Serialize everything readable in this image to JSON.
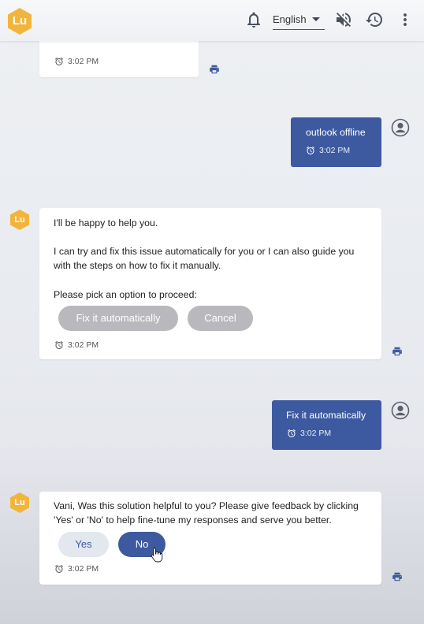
{
  "header": {
    "logo_text": "Lu",
    "language": "English"
  },
  "messages": {
    "top_partial": {
      "time": "3:02 PM"
    },
    "user1": {
      "text": "outlook offline",
      "time": "3:02 PM"
    },
    "bot1": {
      "line1": "I'll be happy to help you.",
      "line2": "I can try and fix this issue automatically for you or I can also guide you",
      "line3": "with the steps on how to fix it manually.",
      "line4": "Please pick an option to proceed:",
      "option_fix": "Fix it automatically",
      "option_cancel": "Cancel",
      "time": "3:02 PM"
    },
    "user2": {
      "text": "Fix it automatically",
      "time": "3:02 PM"
    },
    "bot2": {
      "line1": "Vani, Was this solution helpful to you? Please give feedback by clicking",
      "line2": "'Yes' or 'No' to help fine-tune my responses and serve you better.",
      "option_yes": "Yes",
      "option_no": "No",
      "time": "3:02 PM"
    }
  },
  "colors": {
    "accent": "#3d5aa0",
    "logo": "#f1b53c",
    "disabled_button": "#b9b9bd"
  },
  "icons": [
    "bell-icon",
    "chevron-down-icon",
    "volume-off-icon",
    "history-icon",
    "more-vert-icon",
    "alarm-clock-icon",
    "print-icon",
    "user-avatar-icon",
    "cursor-hand-icon"
  ]
}
